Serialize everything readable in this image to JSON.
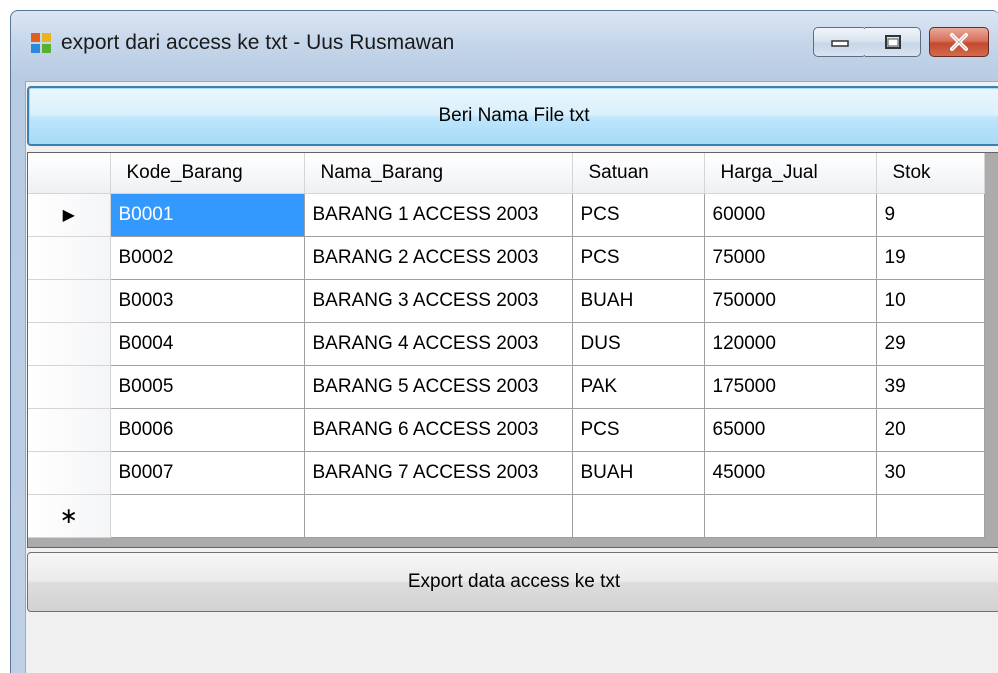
{
  "window": {
    "title": "export dari access ke txt - Uus Rusmawan"
  },
  "title_buttons": {
    "minimize_icon": "minimize-icon",
    "maximize_icon": "maximize-icon",
    "close_icon": "close-icon"
  },
  "buttons": {
    "name_file_label": "Beri Nama File txt",
    "export_label": "Export data access ke txt"
  },
  "grid": {
    "columns": [
      "Kode_Barang",
      "Nama_Barang",
      "Satuan",
      "Harga_Jual",
      "Stok"
    ],
    "current_row_marker": "▶",
    "new_row_marker": "∗",
    "rows": [
      [
        "B0001",
        "BARANG 1 ACCESS 2003",
        "PCS",
        "60000",
        "9"
      ],
      [
        "B0002",
        "BARANG 2 ACCESS 2003",
        "PCS",
        "75000",
        "19"
      ],
      [
        "B0003",
        "BARANG 3 ACCESS 2003",
        "BUAH",
        "750000",
        "10"
      ],
      [
        "B0004",
        "BARANG 4 ACCESS 2003",
        "DUS",
        "120000",
        "29"
      ],
      [
        "B0005",
        "BARANG 5 ACCESS 2003",
        "PAK",
        "175000",
        "39"
      ],
      [
        "B0006",
        "BARANG 6 ACCESS 2003",
        "PCS",
        "65000",
        "20"
      ],
      [
        "B0007",
        "BARANG 7 ACCESS 2003",
        "BUAH",
        "45000",
        "30"
      ]
    ]
  },
  "colors": {
    "selection": "#3399ff",
    "close_button": "#c24a2f",
    "focus_border": "#3c7fb1"
  }
}
